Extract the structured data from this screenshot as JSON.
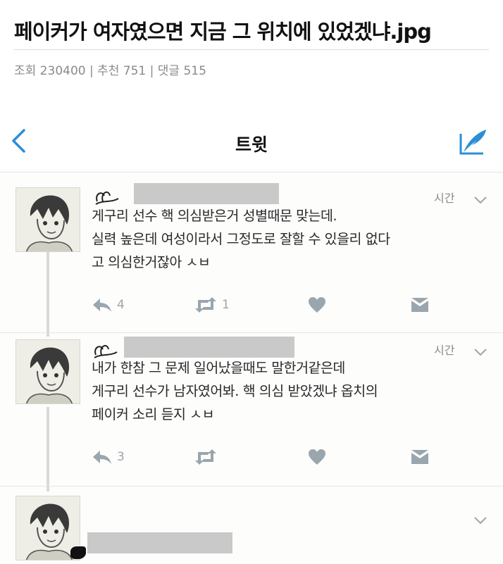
{
  "post": {
    "title": "페이커가 여자였으면 지금 그 위치에 있었겠냐.jpg",
    "meta": "조회 230400 | 추천 751 | 댓글 515"
  },
  "twitter": {
    "nav_title": "트윗",
    "icons": {
      "back": "back-chevron-icon",
      "compose": "compose-icon"
    }
  },
  "tweets": [
    {
      "time": "시간",
      "lines": [
        "게구리 선수 핵 의심받은거 성별때문 맞는데.",
        "실력 높은데 여성이라서 그정도로 잘할 수 있을리 없다",
        "고 의심한거잖아 ㅅㅂ"
      ],
      "reply_count": "4",
      "retweet_count": "1"
    },
    {
      "time": "시간",
      "lines": [
        "내가 한참 그 문제 일어났을때도 말한거같은데",
        "게구리 선수가 남자였어봐. 핵 의심 받았겠냐 옵치의",
        "페이커 소리 듣지 ㅅㅂ"
      ],
      "reply_count": "3",
      "retweet_count": ""
    },
    {
      "time": "",
      "lines": [],
      "reply_count": "",
      "retweet_count": ""
    }
  ],
  "colors": {
    "icon_gray": "#9aa6ad",
    "twitter_blue": "#2a8fd6",
    "redaction": "#c9c9c9"
  }
}
